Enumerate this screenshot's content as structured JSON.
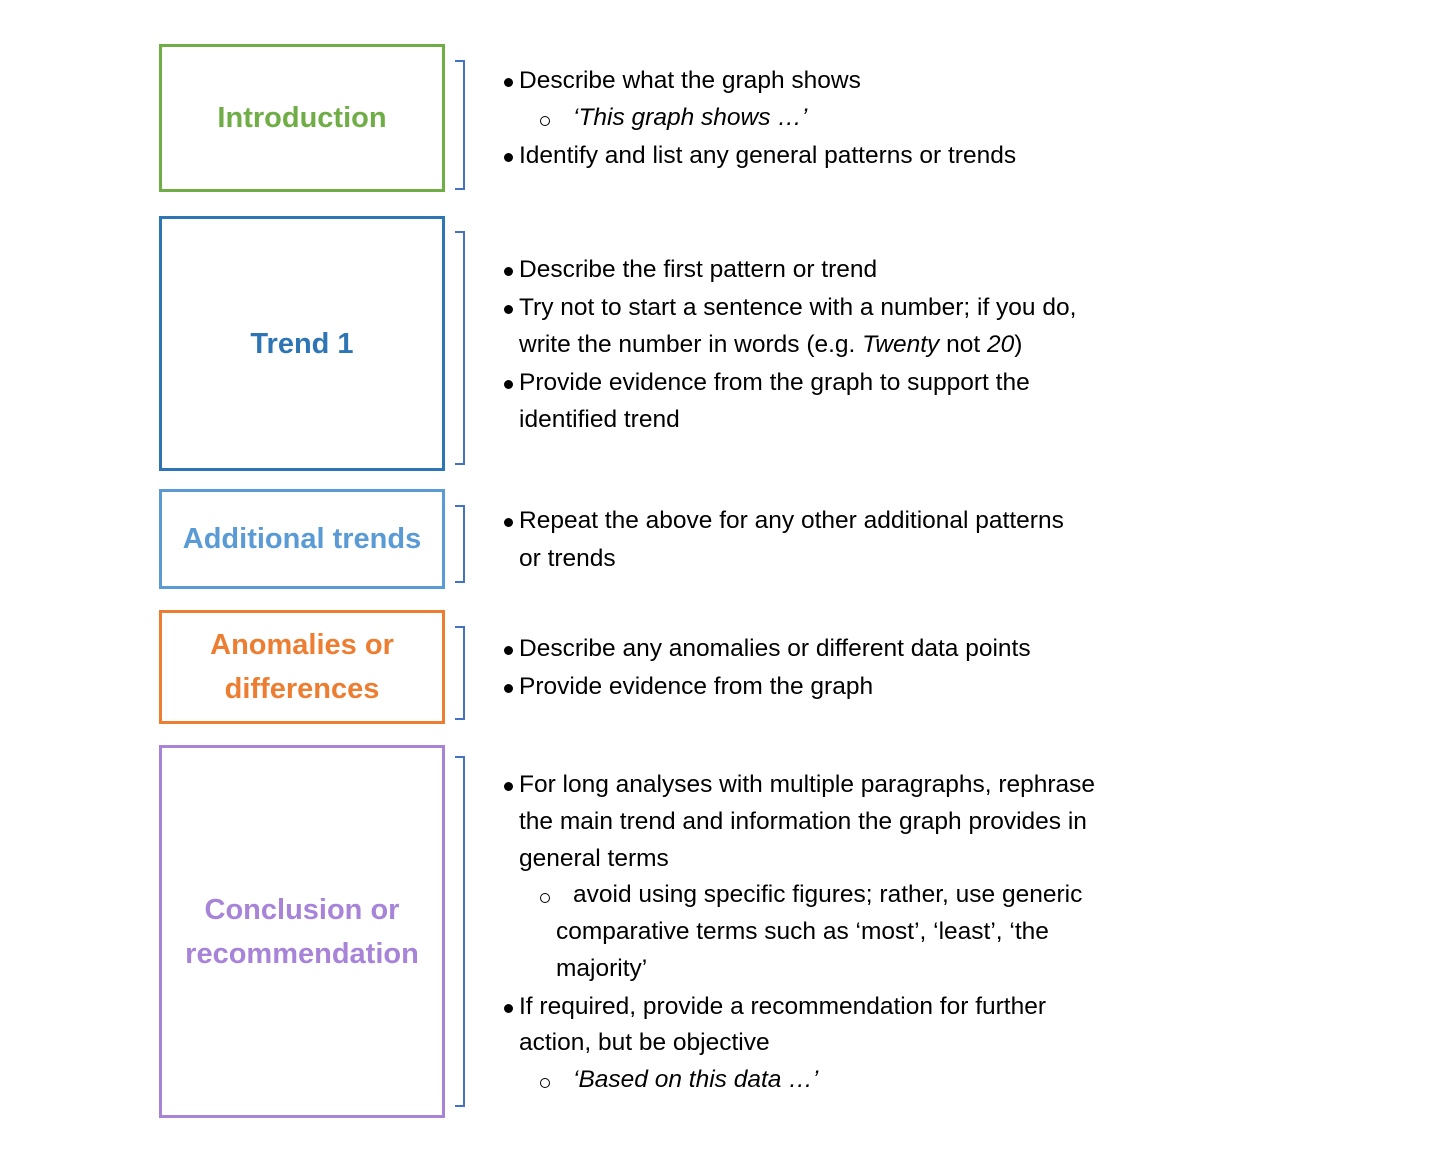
{
  "colors": {
    "introduction": "#70ad47",
    "trend1": "#2e75b6",
    "additional": "#5b9bd5",
    "anomalies": "#ed7d31",
    "conclusion": "#a884d8",
    "bracket": "#4472c4"
  },
  "sections": [
    {
      "label": "Introduction",
      "color": "#70ad47",
      "lines": [
        {
          "kind": "bullet",
          "segs": [
            {
              "t": "Describe what the graph shows"
            }
          ]
        },
        {
          "kind": "sub",
          "segs": [
            {
              "t": "‘",
              "i": true
            },
            {
              "t": "This graph shows …’",
              "i": true
            }
          ]
        },
        {
          "kind": "bullet",
          "segs": [
            {
              "t": "Identify and list any general patterns or trends"
            }
          ]
        }
      ]
    },
    {
      "label": "Trend 1",
      "color": "#2e75b6",
      "lines": [
        {
          "kind": "bullet",
          "segs": [
            {
              "t": "Describe the first pattern or trend"
            }
          ]
        },
        {
          "kind": "bullet",
          "segs": [
            {
              "t": "Try not to start a sentence with a number; if you do,"
            }
          ]
        },
        {
          "kind": "cont",
          "segs": [
            {
              "t": "write the number in words (e.g. "
            },
            {
              "t": "Twenty",
              "i": true
            },
            {
              "t": " not "
            },
            {
              "t": "20",
              "i": true
            },
            {
              "t": ")"
            }
          ]
        },
        {
          "kind": "bullet",
          "segs": [
            {
              "t": "Provide evidence from the graph to support the"
            }
          ]
        },
        {
          "kind": "cont",
          "segs": [
            {
              "t": "identified trend"
            }
          ]
        }
      ]
    },
    {
      "label": "Additional trends",
      "color": "#5b9bd5",
      "lines": [
        {
          "kind": "bullet",
          "segs": [
            {
              "t": "Repeat the above for any other additional patterns"
            }
          ]
        },
        {
          "kind": "cont",
          "segs": [
            {
              "t": "or trends"
            }
          ]
        }
      ]
    },
    {
      "label": "Anomalies or\ndifferences",
      "color": "#ed7d31",
      "lines": [
        {
          "kind": "bullet",
          "segs": [
            {
              "t": "Describe any anomalies or different data points"
            }
          ]
        },
        {
          "kind": "bullet",
          "segs": [
            {
              "t": "Provide evidence from the graph"
            }
          ]
        }
      ]
    },
    {
      "label": "Conclusion or\nrecommendation",
      "color": "#a884d8",
      "lines": [
        {
          "kind": "bullet",
          "segs": [
            {
              "t": "For long analyses with multiple paragraphs, rephrase"
            }
          ]
        },
        {
          "kind": "cont",
          "segs": [
            {
              "t": "the main trend and information the graph provides in"
            }
          ]
        },
        {
          "kind": "cont",
          "segs": [
            {
              "t": "general terms"
            }
          ]
        },
        {
          "kind": "sub",
          "segs": [
            {
              "t": " avoid using specific figures; rather, use generic"
            }
          ]
        },
        {
          "kind": "subcont",
          "segs": [
            {
              "t": "comparative terms such as ‘most’, ‘least’, ‘the"
            }
          ]
        },
        {
          "kind": "subcont",
          "segs": [
            {
              "t": "majority’"
            }
          ]
        },
        {
          "kind": "bullet",
          "segs": [
            {
              "t": "If required, provide a recommendation for further"
            }
          ]
        },
        {
          "kind": "cont",
          "segs": [
            {
              "t": "action, but be objective"
            }
          ]
        },
        {
          "kind": "sub",
          "segs": [
            {
              "t": "‘Based on this data …’",
              "i": true
            }
          ]
        }
      ]
    }
  ]
}
